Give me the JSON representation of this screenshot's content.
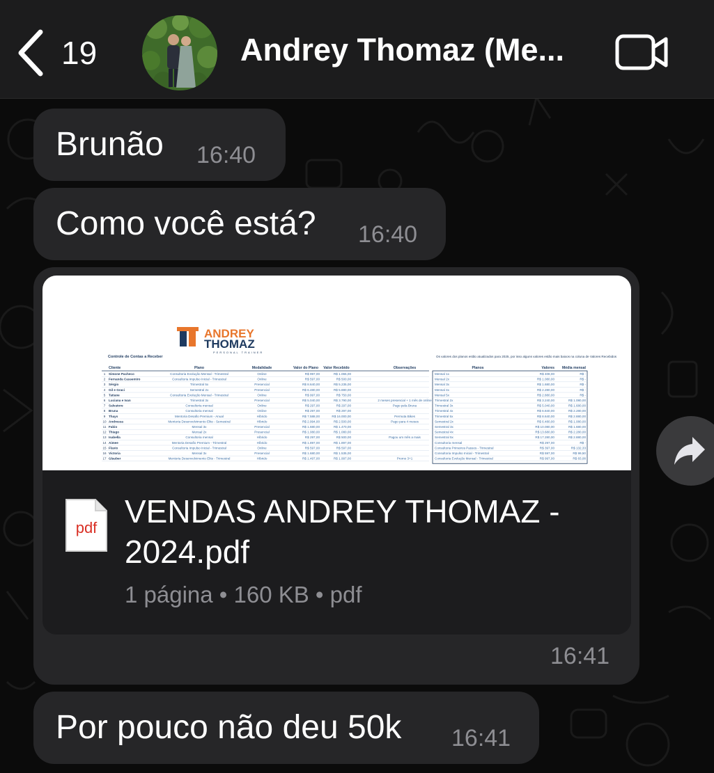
{
  "header": {
    "back_count": "19",
    "contact_name": "Andrey Thomaz (Me..."
  },
  "messages": [
    {
      "text": "Brunão",
      "time": "16:40"
    },
    {
      "text": "Como você está?",
      "time": "16:40"
    },
    {
      "text": "Por pouco não deu 50k",
      "time": "16:41"
    }
  ],
  "document": {
    "icon_label": "pdf",
    "title": "VENDAS ANDREY THOMAZ - 2024.pdf",
    "meta": "1 página • 160 KB • pdf",
    "time": "16:41",
    "preview": {
      "logo_line1": "ANDREY",
      "logo_line2": "THOMAZ",
      "logo_tagline": "PERSONAL TRAINER",
      "sheet_title": "Controle de Contas a Receber",
      "note": "Os valores dos planos estão atualizados para 2025, por isso alguns valores estão mais baixos na coluna de Valores Recebidos",
      "columns": [
        "Cliente",
        "Plano",
        "Modalidade",
        "Valor do Plano",
        "Valor Recebido",
        "Observações"
      ],
      "side_columns": [
        "Planos",
        "Valores",
        "Média mensal"
      ],
      "rows": [
        [
          "Simone Pacheco",
          "Consultoria Evolução Mensal - Trimestral",
          "Online",
          "R$ 997,00",
          "R$ 1.065,00",
          ""
        ],
        [
          "Fernanda Cassemiro",
          "Consultoria Impulso Inicial - Trimestral",
          "Online",
          "R$ 597,00",
          "R$ 500,00",
          ""
        ],
        [
          "Sérgio",
          "Trimestral 5x",
          "Presencial",
          "R$ 8.640,00",
          "R$ 5.235,00",
          ""
        ],
        [
          "Gil e Graci",
          "Semestral 2x",
          "Presencial",
          "R$ 6.480,00",
          "R$ 5.880,00",
          ""
        ],
        [
          "Tatiane",
          "Consultoria Evolução Mensal - Trimestral",
          "Online",
          "R$ 997,00",
          "R$ 750,00",
          ""
        ],
        [
          "Luciana e Ivan",
          "Trimestral 3x",
          "Presencial",
          "R$ 5.040,00",
          "R$ 3.790,00",
          "2 meses presencial + 1 mês de online"
        ],
        [
          "Salvatore",
          "Consultoria mensal",
          "Online",
          "R$ 297,00",
          "R$ 297,00",
          "Pago pela Bruna"
        ],
        [
          "Bruna",
          "Consultoria mensal",
          "Online",
          "R$ 297,00",
          "R$ 297,00",
          ""
        ],
        [
          "Thays",
          "Mentoria Desafio Premium - Anual",
          "Híbrido",
          "R$ 7.588,00",
          "R$ 16.000,00",
          "Permuta Bikes"
        ],
        [
          "Andressa",
          "Mentoria Desenvolvimento Elite - Semestral",
          "Híbrido",
          "R$ 2.994,00",
          "R$ 2.500,00",
          "Pago para 4 meses"
        ],
        [
          "Fabio",
          "Mensal 3x",
          "Presencial",
          "R$ 1.680,00",
          "R$ 1.470,00",
          ""
        ],
        [
          "Thiago",
          "Mensal 2x",
          "Presencial",
          "R$ 1.080,00",
          "R$ 1.080,00",
          ""
        ],
        [
          "Isabella",
          "Consultoria mensal",
          "Híbrido",
          "R$ 297,00",
          "R$ 500,00",
          "Pagou um mês a mais"
        ],
        [
          "Aimee",
          "Mentoria Desafio Premium - Trimestral",
          "Híbrido",
          "R$ 1.897,00",
          "R$ 1.897,00",
          ""
        ],
        [
          "Flavio",
          "Consultoria Impulso Inicial - Trimestral",
          "Online",
          "R$ 597,00",
          "R$ 597,00",
          ""
        ],
        [
          "Victoria",
          "Mensal 3x",
          "Presencial",
          "R$ 1.680,00",
          "R$ 1.535,00",
          ""
        ],
        [
          "Glauber",
          "Mentoria Desenvolvimento Elite - Trimestral",
          "Híbrido",
          "R$ 1.497,00",
          "R$ 1.997,00",
          "Promo 3+1"
        ]
      ],
      "side_rows": [
        [
          "Mensal 1x",
          "R$ 408,00",
          "R$ -"
        ],
        [
          "Mensal 2x",
          "R$ 1.080,00",
          "R$ -"
        ],
        [
          "Mensal 3x",
          "R$ 1.680,00",
          "R$ -"
        ],
        [
          "Mensal 4x",
          "R$ 2.280,00",
          "R$ -"
        ],
        [
          "Mensal 5x",
          "R$ 2.880,00",
          "R$ -"
        ],
        [
          "Trimestral 2x",
          "R$ 3.240,00",
          "R$ 1.080,00"
        ],
        [
          "Trimestral 3x",
          "R$ 5.040,00",
          "R$ 1.680,00"
        ],
        [
          "Trimestral 4x",
          "R$ 6.840,00",
          "R$ 2.280,00"
        ],
        [
          "Trimestral 5x",
          "R$ 8.640,00",
          "R$ 2.880,00"
        ],
        [
          "Semestral 2x",
          "R$ 6.480,00",
          "R$ 1.080,00"
        ],
        [
          "Semestral 3x",
          "R$ 10.080,00",
          "R$ 1.680,00"
        ],
        [
          "Semestral 4x",
          "R$ 13.680,00",
          "R$ 2.280,00"
        ],
        [
          "Semestral 5x",
          "R$ 17.280,00",
          "R$ 2.880,00"
        ],
        [
          "Consultoria mensal",
          "R$ 297,00",
          "R$ -"
        ],
        [
          "Consultoria Primeiros Passos - Trimestral",
          "R$ 397,00",
          "R$ 132,33"
        ],
        [
          "Consultoria Impulso Inicial - Trimestral",
          "R$ 597,00",
          "R$ 99,50"
        ],
        [
          "Consultoria Evolução Mensal - Trimestral",
          "R$ 997,00",
          "R$ 83,08"
        ]
      ]
    }
  },
  "colors": {
    "header_bg": "#1c1c1d",
    "bubble_bg": "#262628",
    "time_text": "#8e8e93",
    "logo_orange": "#e8762c",
    "logo_navy": "#1e3a5f",
    "pdf_red": "#d93025"
  },
  "icons": {
    "back": "chevron-left-icon",
    "video": "video-camera-icon",
    "forward": "forward-arrow-icon",
    "document": "pdf-file-icon"
  }
}
